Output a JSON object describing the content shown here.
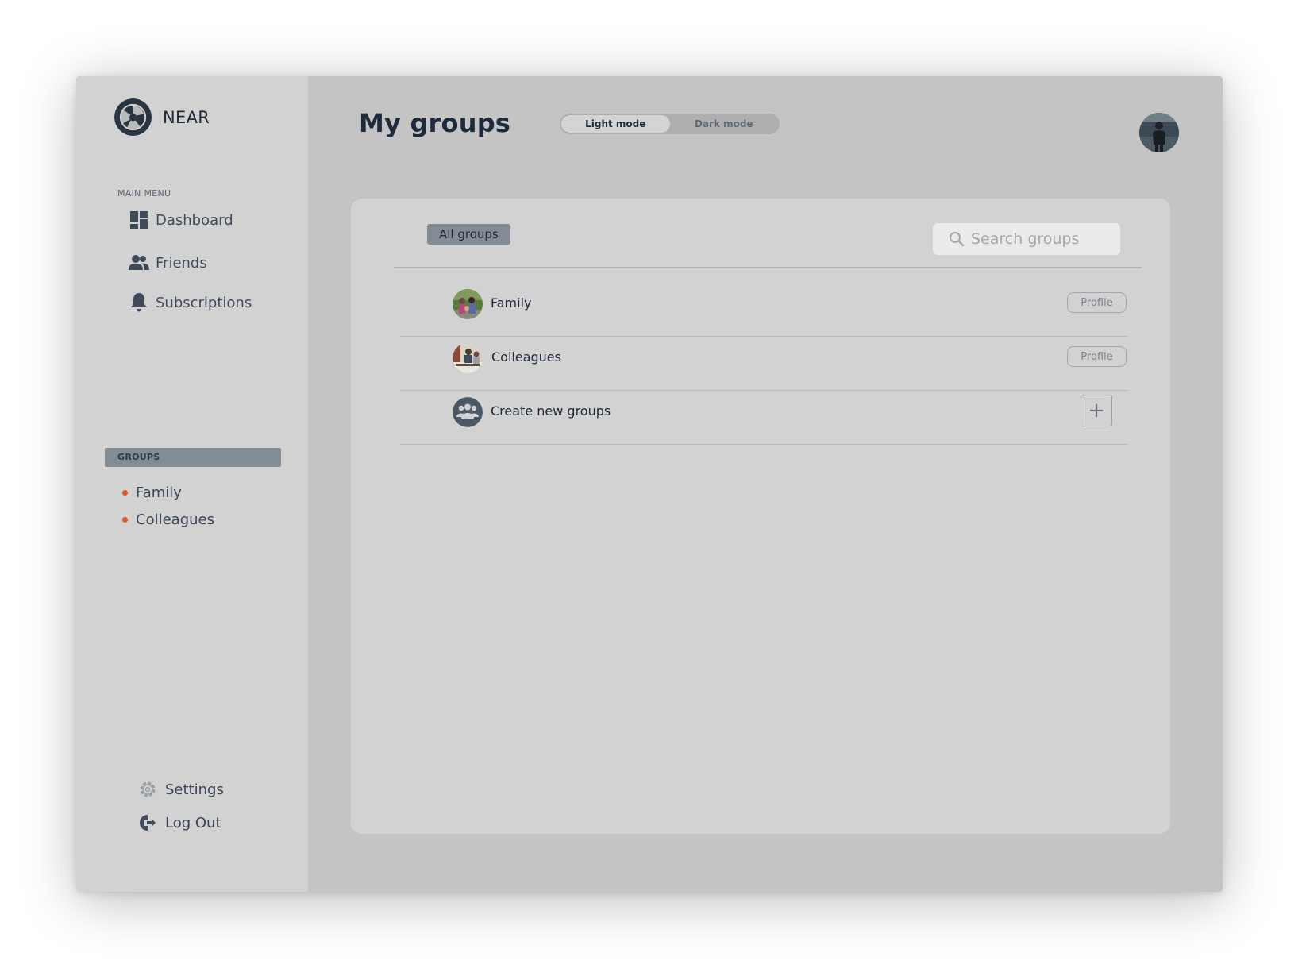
{
  "app": {
    "brand_name": "NEAR"
  },
  "sidebar": {
    "main_menu_label": "MAIN MENU",
    "menu_items": [
      {
        "label": "Dashboard",
        "icon": "dashboard-icon"
      },
      {
        "label": "Friends",
        "icon": "friends-icon"
      },
      {
        "label": "Subscriptions",
        "icon": "bell-icon"
      }
    ],
    "groups_label": "GROUPS",
    "groups": [
      {
        "label": "Family"
      },
      {
        "label": "Colleagues"
      }
    ],
    "bottom_items": [
      {
        "label": "Settings",
        "icon": "gear-icon"
      },
      {
        "label": "Log Out",
        "icon": "logout-icon"
      }
    ]
  },
  "header": {
    "title": "My groups",
    "mode_toggle": {
      "light": "Light mode",
      "dark": "Dark mode",
      "selected": "Light mode"
    }
  },
  "panel": {
    "tab_label": "All groups",
    "search_placeholder": "Search groups",
    "rows": [
      {
        "name": "Family",
        "action": "Profile"
      },
      {
        "name": "Colleagues",
        "action": "Profile"
      },
      {
        "name": "Create new groups",
        "action": "+"
      }
    ]
  },
  "colors": {
    "accent_dot": "#e2552d",
    "sidebar_bg": "#d2d2d2",
    "main_bg": "#c4c4c4",
    "text_dark": "#1d2b3c"
  }
}
